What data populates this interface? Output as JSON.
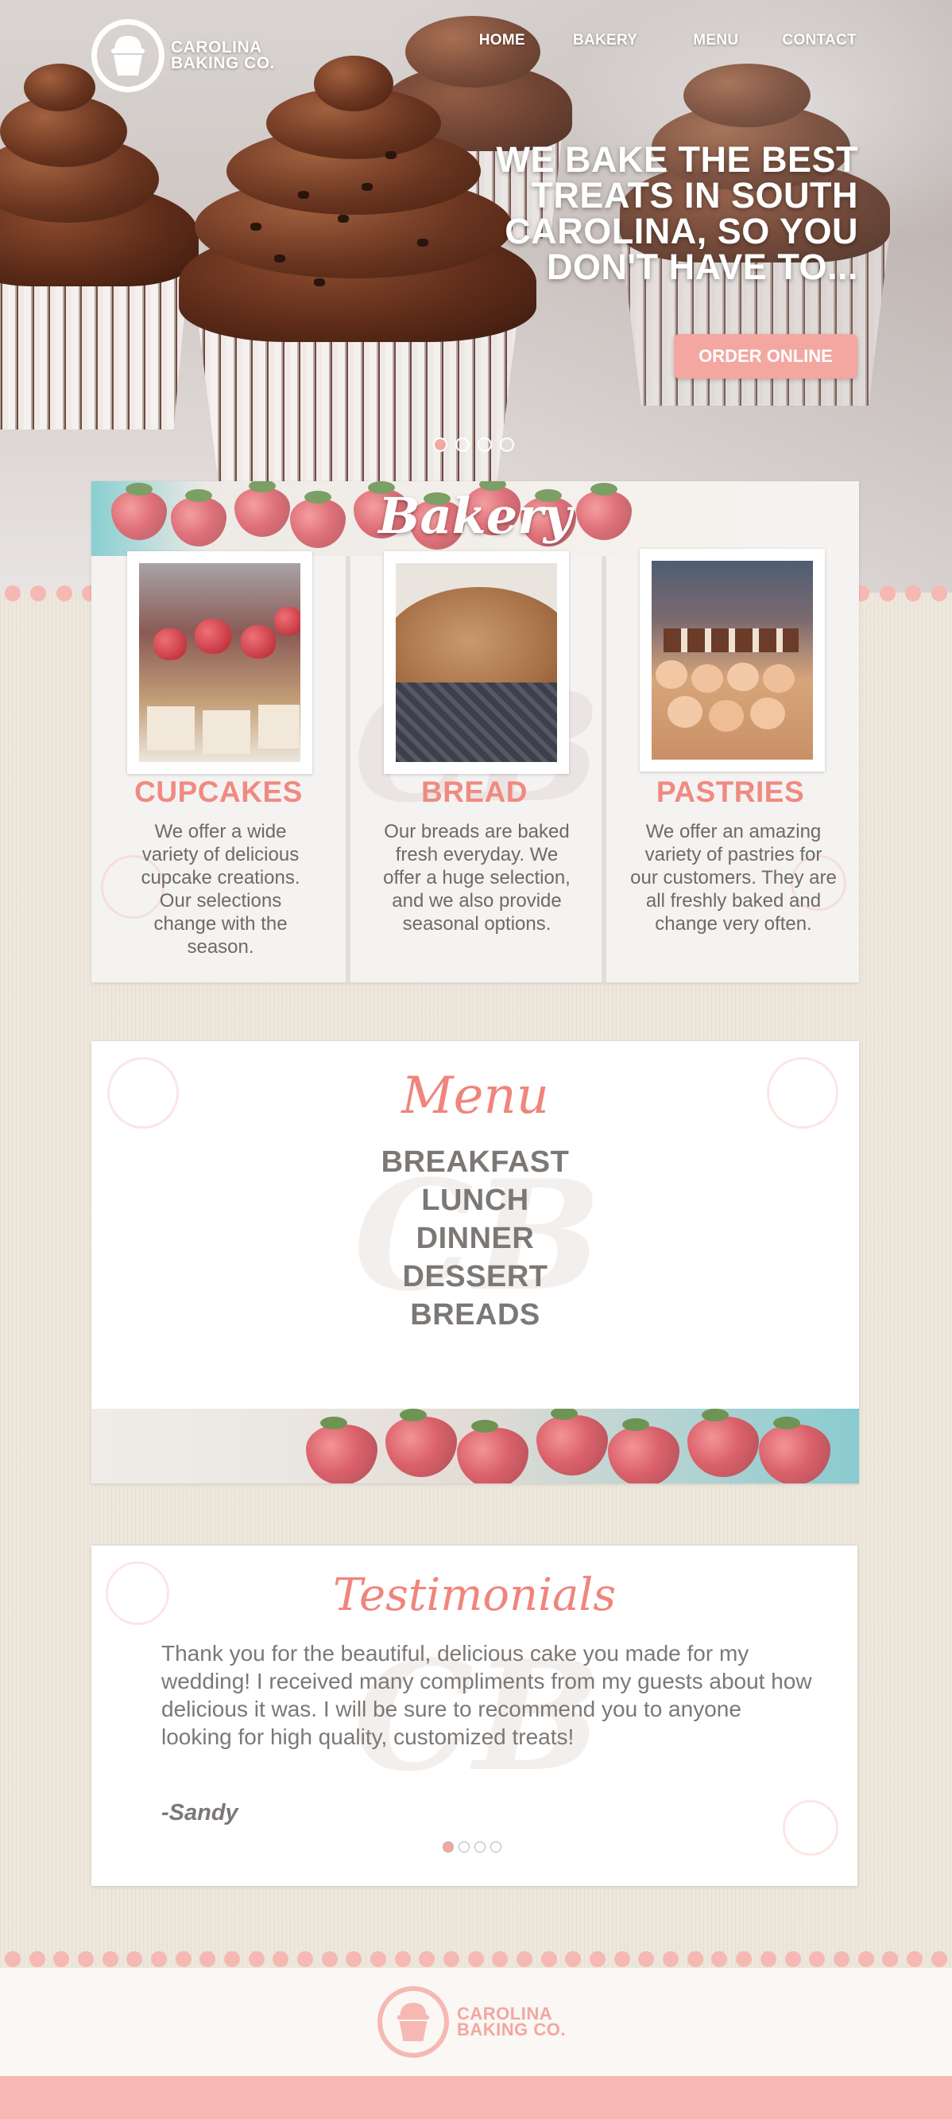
{
  "brand": {
    "name_line1": "CAROLINA",
    "name_line2": "BAKING CO."
  },
  "nav": {
    "home": "HOME",
    "bakery": "BAKERY",
    "menu": "MENU",
    "contact": "CONTACT"
  },
  "hero": {
    "headline": "WE BAKE THE BEST TREATS IN SOUTH CAROLINA, SO YOU DON'T HAVE TO...",
    "cta": "ORDER ONLINE",
    "slide_count": 4,
    "active_slide": 1
  },
  "bakery": {
    "title": "Bakery",
    "items": [
      {
        "title": "CUPCAKES",
        "text": "We offer a wide variety of delicious cupcake creations. Our selections change with the season."
      },
      {
        "title": "BREAD",
        "text": "Our breads are baked fresh everyday. We offer a huge selection, and we also provide seasonal options."
      },
      {
        "title": "PASTRIES",
        "text": "We offer an amazing variety of pastries for our customers. They are all freshly baked and change very often."
      }
    ]
  },
  "menu": {
    "title": "Menu",
    "items": [
      "BREAKFAST",
      "LUNCH",
      "DINNER",
      "DESSERT",
      "BREADS"
    ]
  },
  "testimonials": {
    "title": "Testimonials",
    "quote": "Thank you for the beautiful, delicious cake you made for my wedding! I received many compliments from my guests about how delicious it was. I will be sure to recommend you to anyone looking for high quality, customized treats!",
    "author": "-Sandy",
    "slide_count": 4,
    "active_slide": 1
  },
  "watermark_monogram": "CB",
  "colors": {
    "accent_pink": "#f3a7a0",
    "title_coral": "#f08a80",
    "text_gray": "#7c7876",
    "scallop": "#f6b8b2"
  },
  "icons": {
    "logo": "cupcake-icon"
  }
}
